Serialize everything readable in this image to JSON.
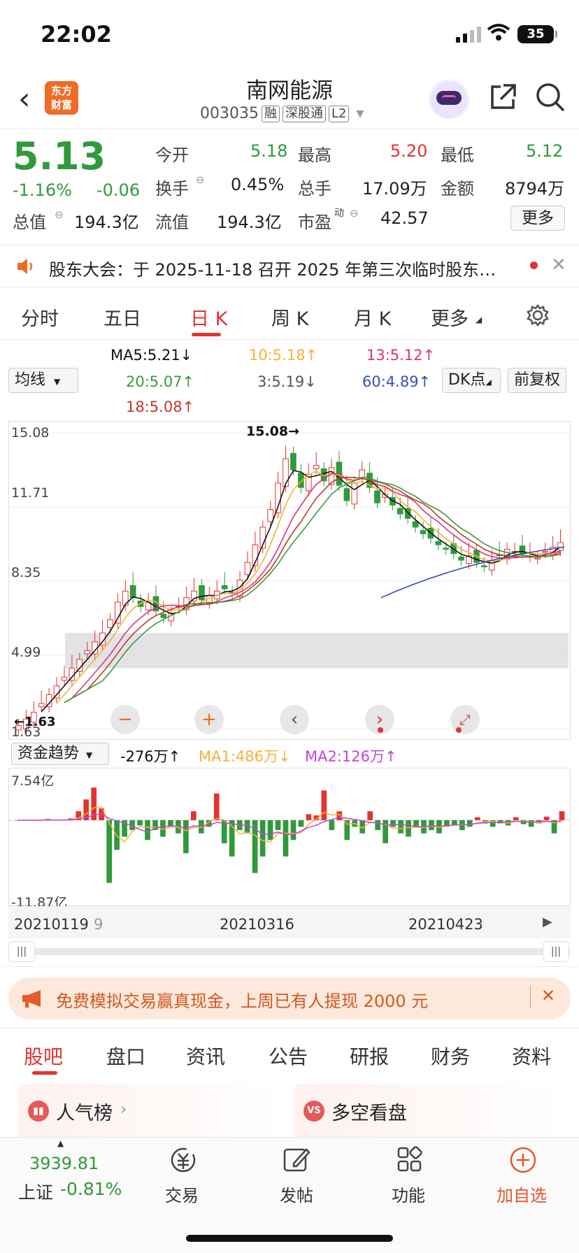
{
  "status_bar": {
    "time": "22:02",
    "battery": "35"
  },
  "header": {
    "back": "‹",
    "logo_text": "东方\n财富",
    "stock_name": "南网能源",
    "stock_code": "003035",
    "tags": [
      "融",
      "深股通",
      "L2"
    ]
  },
  "quote": {
    "price": "5.13",
    "change_pct": "-1.16%",
    "change": "-0.06",
    "open_label": "今开",
    "open": "5.18",
    "high_label": "最高",
    "high": "5.20",
    "low_label": "最低",
    "low": "5.12",
    "turnover_label": "换手",
    "turnover": "0.45%",
    "volume_label": "总手",
    "volume": "17.09万",
    "amount_label": "金额",
    "amount": "8794万",
    "mktcap_label": "总值",
    "mktcap": "194.3亿",
    "float_label": "流值",
    "float_cap": "194.3亿",
    "pe_label": "市盈",
    "pe_sup": "动",
    "pe": "42.57",
    "more": "更多"
  },
  "notice": {
    "text": "股东大会：于 2025-11-18 召开 2025 年第三次临时股东…"
  },
  "tabs": [
    "分时",
    "五日",
    "日 K",
    "周 K",
    "月 K",
    "更多"
  ],
  "ma_bar": {
    "selector": "均线",
    "ma5": "MA5:5.21↓",
    "ma10": "10:5.18↑",
    "ma13": "13:5.12↑",
    "ma20": "20:5.07↑",
    "ma3": "3:5.19↓",
    "ma60": "60:4.89↑",
    "ma18": "18:5.08↑",
    "dk": "DK点",
    "adjust": "前复权"
  },
  "kchart": {
    "y_ticks": [
      "15.08",
      "11.71",
      "8.35",
      "4.99",
      "1.63"
    ],
    "max_label": "15.08→",
    "min_label": "←1.63",
    "colors": {
      "up": "#e2342f",
      "down": "#2f9a3c",
      "ma5": "#111111",
      "ma10": "#f5b237",
      "ma13": "#e0337a",
      "ma20": "#3a9c3a",
      "ma18": "#c0392b",
      "ma60": "#3a4fb8"
    }
  },
  "chart_data": {
    "type": "candlestick",
    "y_range": [
      1.63,
      15.08
    ],
    "x_range": [
      "20210119",
      "20210423"
    ],
    "closes": [
      1.8,
      2.1,
      2.4,
      2.8,
      3.2,
      3.6,
      4.0,
      4.4,
      4.8,
      5.2,
      5.6,
      6.0,
      6.6,
      7.4,
      7.9,
      7.6,
      7.2,
      7.4,
      7.0,
      6.7,
      6.9,
      7.2,
      7.6,
      7.9,
      7.5,
      7.7,
      7.9,
      8.0,
      7.8,
      8.4,
      9.2,
      10.0,
      10.8,
      11.6,
      12.8,
      13.9,
      13.4,
      12.6,
      13.2,
      13.6,
      12.9,
      13.5,
      12.7,
      12.0,
      12.8,
      13.4,
      12.6,
      11.9,
      12.3,
      11.8,
      11.4,
      11.2,
      10.8,
      10.5,
      10.3,
      10.0,
      9.8,
      9.6,
      9.3,
      9.5,
      9.2,
      9.0,
      9.3,
      9.5,
      9.8,
      9.7,
      9.6,
      9.5,
      9.4,
      9.7,
      9.9,
      10.1
    ],
    "volume_panel": {
      "title": "资金趋势",
      "value": "-276万↑",
      "ma1": "MA1:486万↓",
      "ma2": "MA2:126万↑",
      "y_max": "7.54亿",
      "y_min": "-11.87亿",
      "bars": [
        0,
        0,
        0,
        0,
        0.2,
        0,
        0,
        0.3,
        1.5,
        3.5,
        5.5,
        2.0,
        -9.5,
        -4.5,
        -2.5,
        -1.5,
        -0.8,
        -3.0,
        -1.5,
        -2.5,
        -1.0,
        -2.0,
        -5.0,
        1.5,
        -2.0,
        -1.0,
        4.5,
        -3.5,
        -5.5,
        -1.5,
        -2.0,
        -8.0,
        -5.5,
        -3.0,
        -1.5,
        -5.5,
        -3.0,
        -1.0,
        1.0,
        0.8,
        5.0,
        -1.5,
        1.5,
        -3.0,
        -1.0,
        -2.0,
        1.5,
        -1.5,
        -3.5,
        -1.0,
        -2.0,
        -2.5,
        -1.0,
        -2.0,
        -1.5,
        -2.0,
        -1.0,
        -0.8,
        -1.5,
        -1.0,
        0.5,
        -0.5,
        -1.0,
        -0.5,
        -0.8,
        0.5,
        -0.6,
        -1.0,
        -0.5,
        0.6,
        -2.0,
        1.5
      ],
      "dates": [
        "20210119",
        "9",
        "20210316",
        "20210423"
      ]
    }
  },
  "promo": {
    "text": "免费模拟交易赢真现金，上周已有人提现 2000 元"
  },
  "sub_tabs": [
    "股吧",
    "盘口",
    "资讯",
    "公告",
    "研报",
    "财务",
    "资料"
  ],
  "cards": [
    {
      "title": "人气榜"
    },
    {
      "title": "多空看盘"
    }
  ],
  "bottom_bar": {
    "index_value": "3939.81",
    "index_name": "上证",
    "index_change": "-0.81%",
    "items": [
      "交易",
      "发帖",
      "功能",
      "加自选"
    ]
  }
}
